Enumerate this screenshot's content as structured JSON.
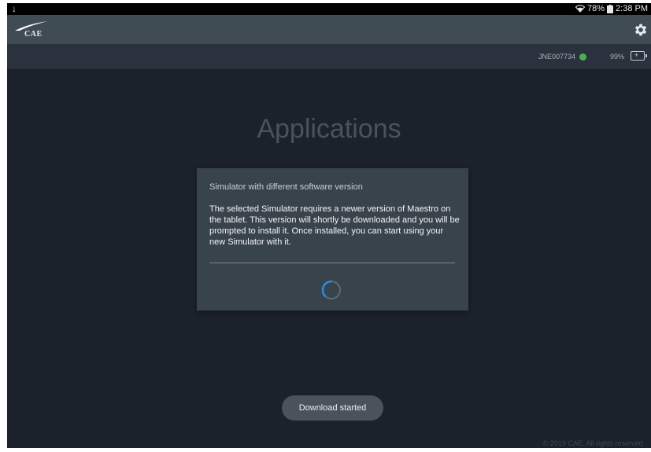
{
  "status_bar": {
    "download_indicator": "↓",
    "battery_percent": "78%",
    "time": "2:38 PM"
  },
  "app_bar": {
    "logo_text": "CAE",
    "settings_icon": "gear-icon"
  },
  "info_bar": {
    "simulator_id": "JNE007734",
    "connection_status_color": "#4caf50",
    "simulator_battery": "99%"
  },
  "main": {
    "title": "Applications"
  },
  "dialog": {
    "title": "Simulator with different software version",
    "body": "The selected Simulator requires a newer version of Maestro on the tablet. This version will shortly be downloaded and you will be prompted to install it. Once installed, you can start using your new Simulator with it."
  },
  "toast": {
    "message": "Download started"
  },
  "footer": {
    "copyright": "© 2019 CAE. All rights reserved."
  },
  "colors": {
    "background": "#1b222c",
    "app_bar": "#3f4c53",
    "dialog": "#39434c",
    "spinner_accent": "#2b8ce6"
  }
}
